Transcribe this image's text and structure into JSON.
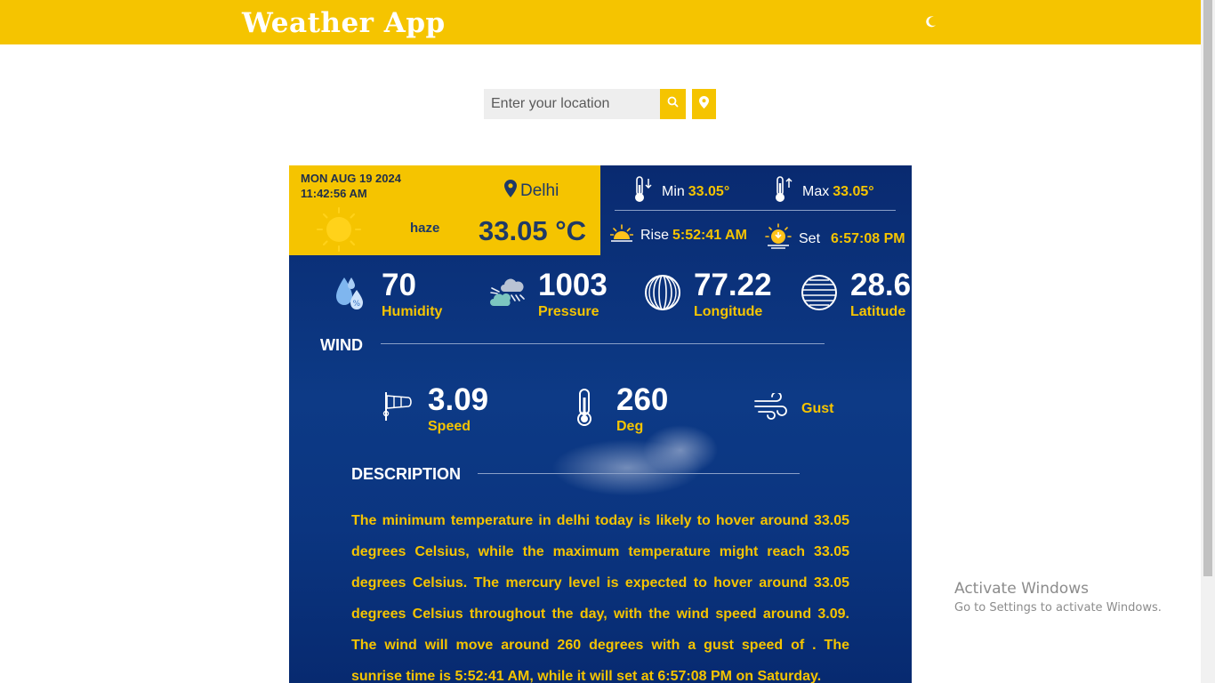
{
  "header": {
    "title": "Weather App",
    "theme_icon": "moon-icon"
  },
  "search": {
    "placeholder": "Enter your location",
    "value": "",
    "search_icon": "search-icon",
    "location_icon": "map-pin-icon"
  },
  "current": {
    "date": "MON AUG 19 2024",
    "time": "11:42:56 AM",
    "city": "Delhi",
    "condition": "haze",
    "temperature": "33.05 °C"
  },
  "minmax": {
    "min_label": "Min",
    "min_value": "33.05°",
    "max_label": "Max",
    "max_value": "33.05°"
  },
  "sun": {
    "rise_label": "Rise",
    "rise_value": "5:52:41 AM",
    "set_label": "Set",
    "set_value": "6:57:08 PM"
  },
  "stats": [
    {
      "value": "70",
      "label": "Humidity"
    },
    {
      "value": "1003",
      "label": "Pressure"
    },
    {
      "value": "77.22",
      "label": "Longitude"
    },
    {
      "value": "28.6",
      "label": "Latitude"
    }
  ],
  "wind": {
    "title": "WIND",
    "speed_value": "3.09",
    "speed_label": "Speed",
    "deg_value": "260",
    "deg_label": "Deg",
    "gust_label": "Gust"
  },
  "description": {
    "title": "DESCRIPTION",
    "text": "The minimum temperature in delhi today is likely to hover around 33.05 degrees Celsius, while the maximum temperature might reach 33.05 degrees Celsius. The mercury level is expected to hover around 33.05 degrees Celsius throughout the day, with the wind speed around 3.09. The wind will move around 260 degrees with a gust speed of . The sunrise time is 5:52:41 AM, while it will set at 6:57:08 PM on Saturday."
  },
  "watermark": {
    "line1": "Activate Windows",
    "line2": "Go to Settings to activate Windows."
  },
  "colors": {
    "accent": "#f5c400",
    "card_bg": "#0b3580",
    "text_dark": "#1f3a66"
  }
}
